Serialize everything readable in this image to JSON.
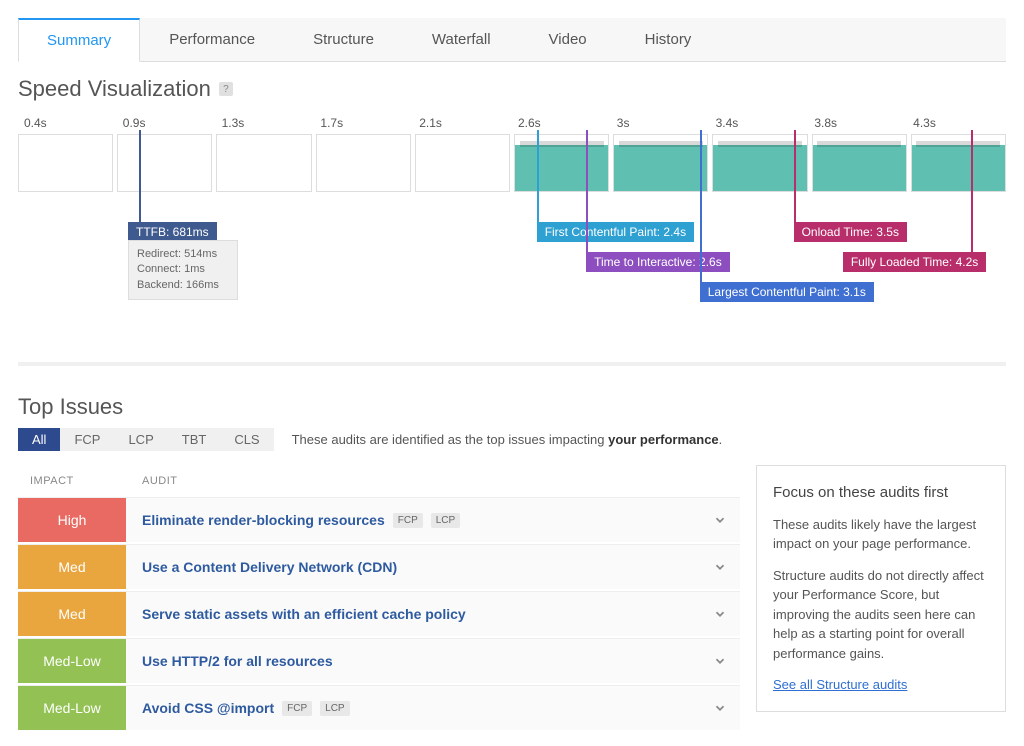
{
  "tabs": [
    "Summary",
    "Performance",
    "Structure",
    "Waterfall",
    "Video",
    "History"
  ],
  "speed_viz": {
    "title": "Speed Visualization",
    "ticks": [
      "0.4s",
      "0.9s",
      "1.3s",
      "1.7s",
      "2.1s",
      "2.6s",
      "3s",
      "3.4s",
      "3.8s",
      "4.3s"
    ],
    "markers": {
      "ttfb": {
        "label": "TTFB: 681ms",
        "details": [
          "Redirect: 514ms",
          "Connect: 1ms",
          "Backend: 166ms"
        ]
      },
      "fcp": {
        "label": "First Contentful Paint: 2.4s"
      },
      "tti": {
        "label": "Time to Interactive: 2.6s"
      },
      "lcp": {
        "label": "Largest Contentful Paint: 3.1s"
      },
      "onload": {
        "label": "Onload Time: 3.5s"
      },
      "flt": {
        "label": "Fully Loaded Time: 4.2s"
      }
    }
  },
  "top_issues": {
    "title": "Top Issues",
    "filters": [
      "All",
      "FCP",
      "LCP",
      "TBT",
      "CLS"
    ],
    "desc_pre": "These audits are identified as the top issues impacting ",
    "desc_bold": "your performance",
    "headers": {
      "impact": "IMPACT",
      "audit": "AUDIT"
    },
    "rows": [
      {
        "impact": "High",
        "class": "high",
        "title": "Eliminate render-blocking resources",
        "badges": [
          "FCP",
          "LCP"
        ]
      },
      {
        "impact": "Med",
        "class": "med",
        "title": "Use a Content Delivery Network (CDN)",
        "badges": []
      },
      {
        "impact": "Med",
        "class": "med",
        "title": "Serve static assets with an efficient cache policy",
        "badges": []
      },
      {
        "impact": "Med-Low",
        "class": "medlow",
        "title": "Use HTTP/2 for all resources",
        "badges": []
      },
      {
        "impact": "Med-Low",
        "class": "medlow",
        "title": "Avoid CSS @import",
        "badges": [
          "FCP",
          "LCP"
        ]
      }
    ]
  },
  "sidebar": {
    "title": "Focus on these audits first",
    "p1": "These audits likely have the largest impact on your page performance.",
    "p2": "Structure audits do not directly affect your Performance Score, but improving the audits seen here can help as a starting point for overall performance gains.",
    "link": "See all Structure audits"
  }
}
